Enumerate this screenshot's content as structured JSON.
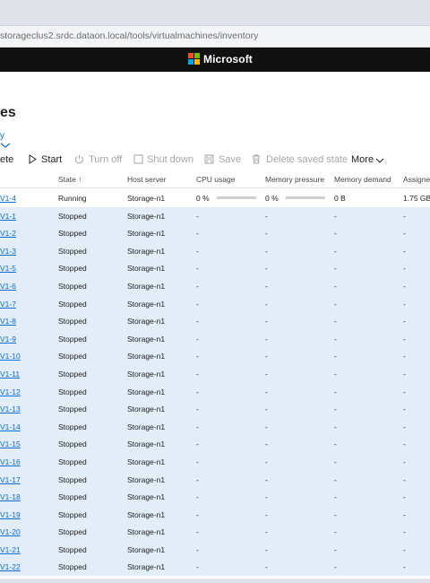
{
  "browser": {
    "address": "storageclus2.srdc.dataon.local/tools/virtualmachines/inventory"
  },
  "header": {
    "brand": "Microsoft",
    "brand_colors": [
      "#f25022",
      "#7fba00",
      "#00a4ef",
      "#ffb900"
    ]
  },
  "page": {
    "title": "es",
    "summary_link": "y"
  },
  "toolbar": {
    "delete_label": "ete",
    "start_label": "Start",
    "turn_off_label": "Turn off",
    "shut_down_label": "Shut down",
    "save_label": "Save",
    "delete_saved_label": "Delete saved state",
    "more_label": "More"
  },
  "table": {
    "columns": {
      "state": "State ↑",
      "host": "Host server",
      "cpu": "CPU usage",
      "mem_pressure": "Memory pressure",
      "mem_demand": "Memory demand",
      "assigned": "Assigned"
    },
    "rows": [
      {
        "name": "V1-4",
        "state": "Running",
        "host": "Storage-n1",
        "cpu": "0 %",
        "cpu_fraction": 0.0,
        "mem": "0 %",
        "mem_fraction": 0.0,
        "demand": "0 B",
        "assigned": "1.75 GB",
        "selected": false
      },
      {
        "name": "V1-1",
        "state": "Stopped",
        "host": "Storage-n1",
        "cpu": "-",
        "mem": "-",
        "demand": "-",
        "assigned": "-",
        "selected": true
      },
      {
        "name": "V1-2",
        "state": "Stopped",
        "host": "Storage-n1",
        "cpu": "-",
        "mem": "-",
        "demand": "-",
        "assigned": "-",
        "selected": true
      },
      {
        "name": "V1-3",
        "state": "Stopped",
        "host": "Storage-n1",
        "cpu": "-",
        "mem": "-",
        "demand": "-",
        "assigned": "-",
        "selected": true
      },
      {
        "name": "V1-5",
        "state": "Stopped",
        "host": "Storage-n1",
        "cpu": "-",
        "mem": "-",
        "demand": "-",
        "assigned": "-",
        "selected": true
      },
      {
        "name": "V1-6",
        "state": "Stopped",
        "host": "Storage-n1",
        "cpu": "-",
        "mem": "-",
        "demand": "-",
        "assigned": "-",
        "selected": true
      },
      {
        "name": "V1-7",
        "state": "Stopped",
        "host": "Storage-n1",
        "cpu": "-",
        "mem": "-",
        "demand": "-",
        "assigned": "-",
        "selected": true
      },
      {
        "name": "V1-8",
        "state": "Stopped",
        "host": "Storage-n1",
        "cpu": "-",
        "mem": "-",
        "demand": "-",
        "assigned": "-",
        "selected": true
      },
      {
        "name": "V1-9",
        "state": "Stopped",
        "host": "Storage-n1",
        "cpu": "-",
        "mem": "-",
        "demand": "-",
        "assigned": "-",
        "selected": true
      },
      {
        "name": "V1-10",
        "state": "Stopped",
        "host": "Storage-n1",
        "cpu": "-",
        "mem": "-",
        "demand": "-",
        "assigned": "-",
        "selected": true
      },
      {
        "name": "V1-11",
        "state": "Stopped",
        "host": "Storage-n1",
        "cpu": "-",
        "mem": "-",
        "demand": "-",
        "assigned": "-",
        "selected": true
      },
      {
        "name": "V1-12",
        "state": "Stopped",
        "host": "Storage-n1",
        "cpu": "-",
        "mem": "-",
        "demand": "-",
        "assigned": "-",
        "selected": true
      },
      {
        "name": "V1-13",
        "state": "Stopped",
        "host": "Storage-n1",
        "cpu": "-",
        "mem": "-",
        "demand": "-",
        "assigned": "-",
        "selected": true
      },
      {
        "name": "V1-14",
        "state": "Stopped",
        "host": "Storage-n1",
        "cpu": "-",
        "mem": "-",
        "demand": "-",
        "assigned": "-",
        "selected": true
      },
      {
        "name": "V1-15",
        "state": "Stopped",
        "host": "Storage-n1",
        "cpu": "-",
        "mem": "-",
        "demand": "-",
        "assigned": "-",
        "selected": true
      },
      {
        "name": "V1-16",
        "state": "Stopped",
        "host": "Storage-n1",
        "cpu": "-",
        "mem": "-",
        "demand": "-",
        "assigned": "-",
        "selected": true
      },
      {
        "name": "V1-17",
        "state": "Stopped",
        "host": "Storage-n1",
        "cpu": "-",
        "mem": "-",
        "demand": "-",
        "assigned": "-",
        "selected": true
      },
      {
        "name": "V1-18",
        "state": "Stopped",
        "host": "Storage-n1",
        "cpu": "-",
        "mem": "-",
        "demand": "-",
        "assigned": "-",
        "selected": true
      },
      {
        "name": "V1-19",
        "state": "Stopped",
        "host": "Storage-n1",
        "cpu": "-",
        "mem": "-",
        "demand": "-",
        "assigned": "-",
        "selected": true
      },
      {
        "name": "V1-20",
        "state": "Stopped",
        "host": "Storage-n1",
        "cpu": "-",
        "mem": "-",
        "demand": "-",
        "assigned": "-",
        "selected": true
      },
      {
        "name": "V1-21",
        "state": "Stopped",
        "host": "Storage-n1",
        "cpu": "-",
        "mem": "-",
        "demand": "-",
        "assigned": "-",
        "selected": true
      },
      {
        "name": "V1-22",
        "state": "Stopped",
        "host": "Storage-n1",
        "cpu": "-",
        "mem": "-",
        "demand": "-",
        "assigned": "-",
        "selected": true
      }
    ]
  }
}
